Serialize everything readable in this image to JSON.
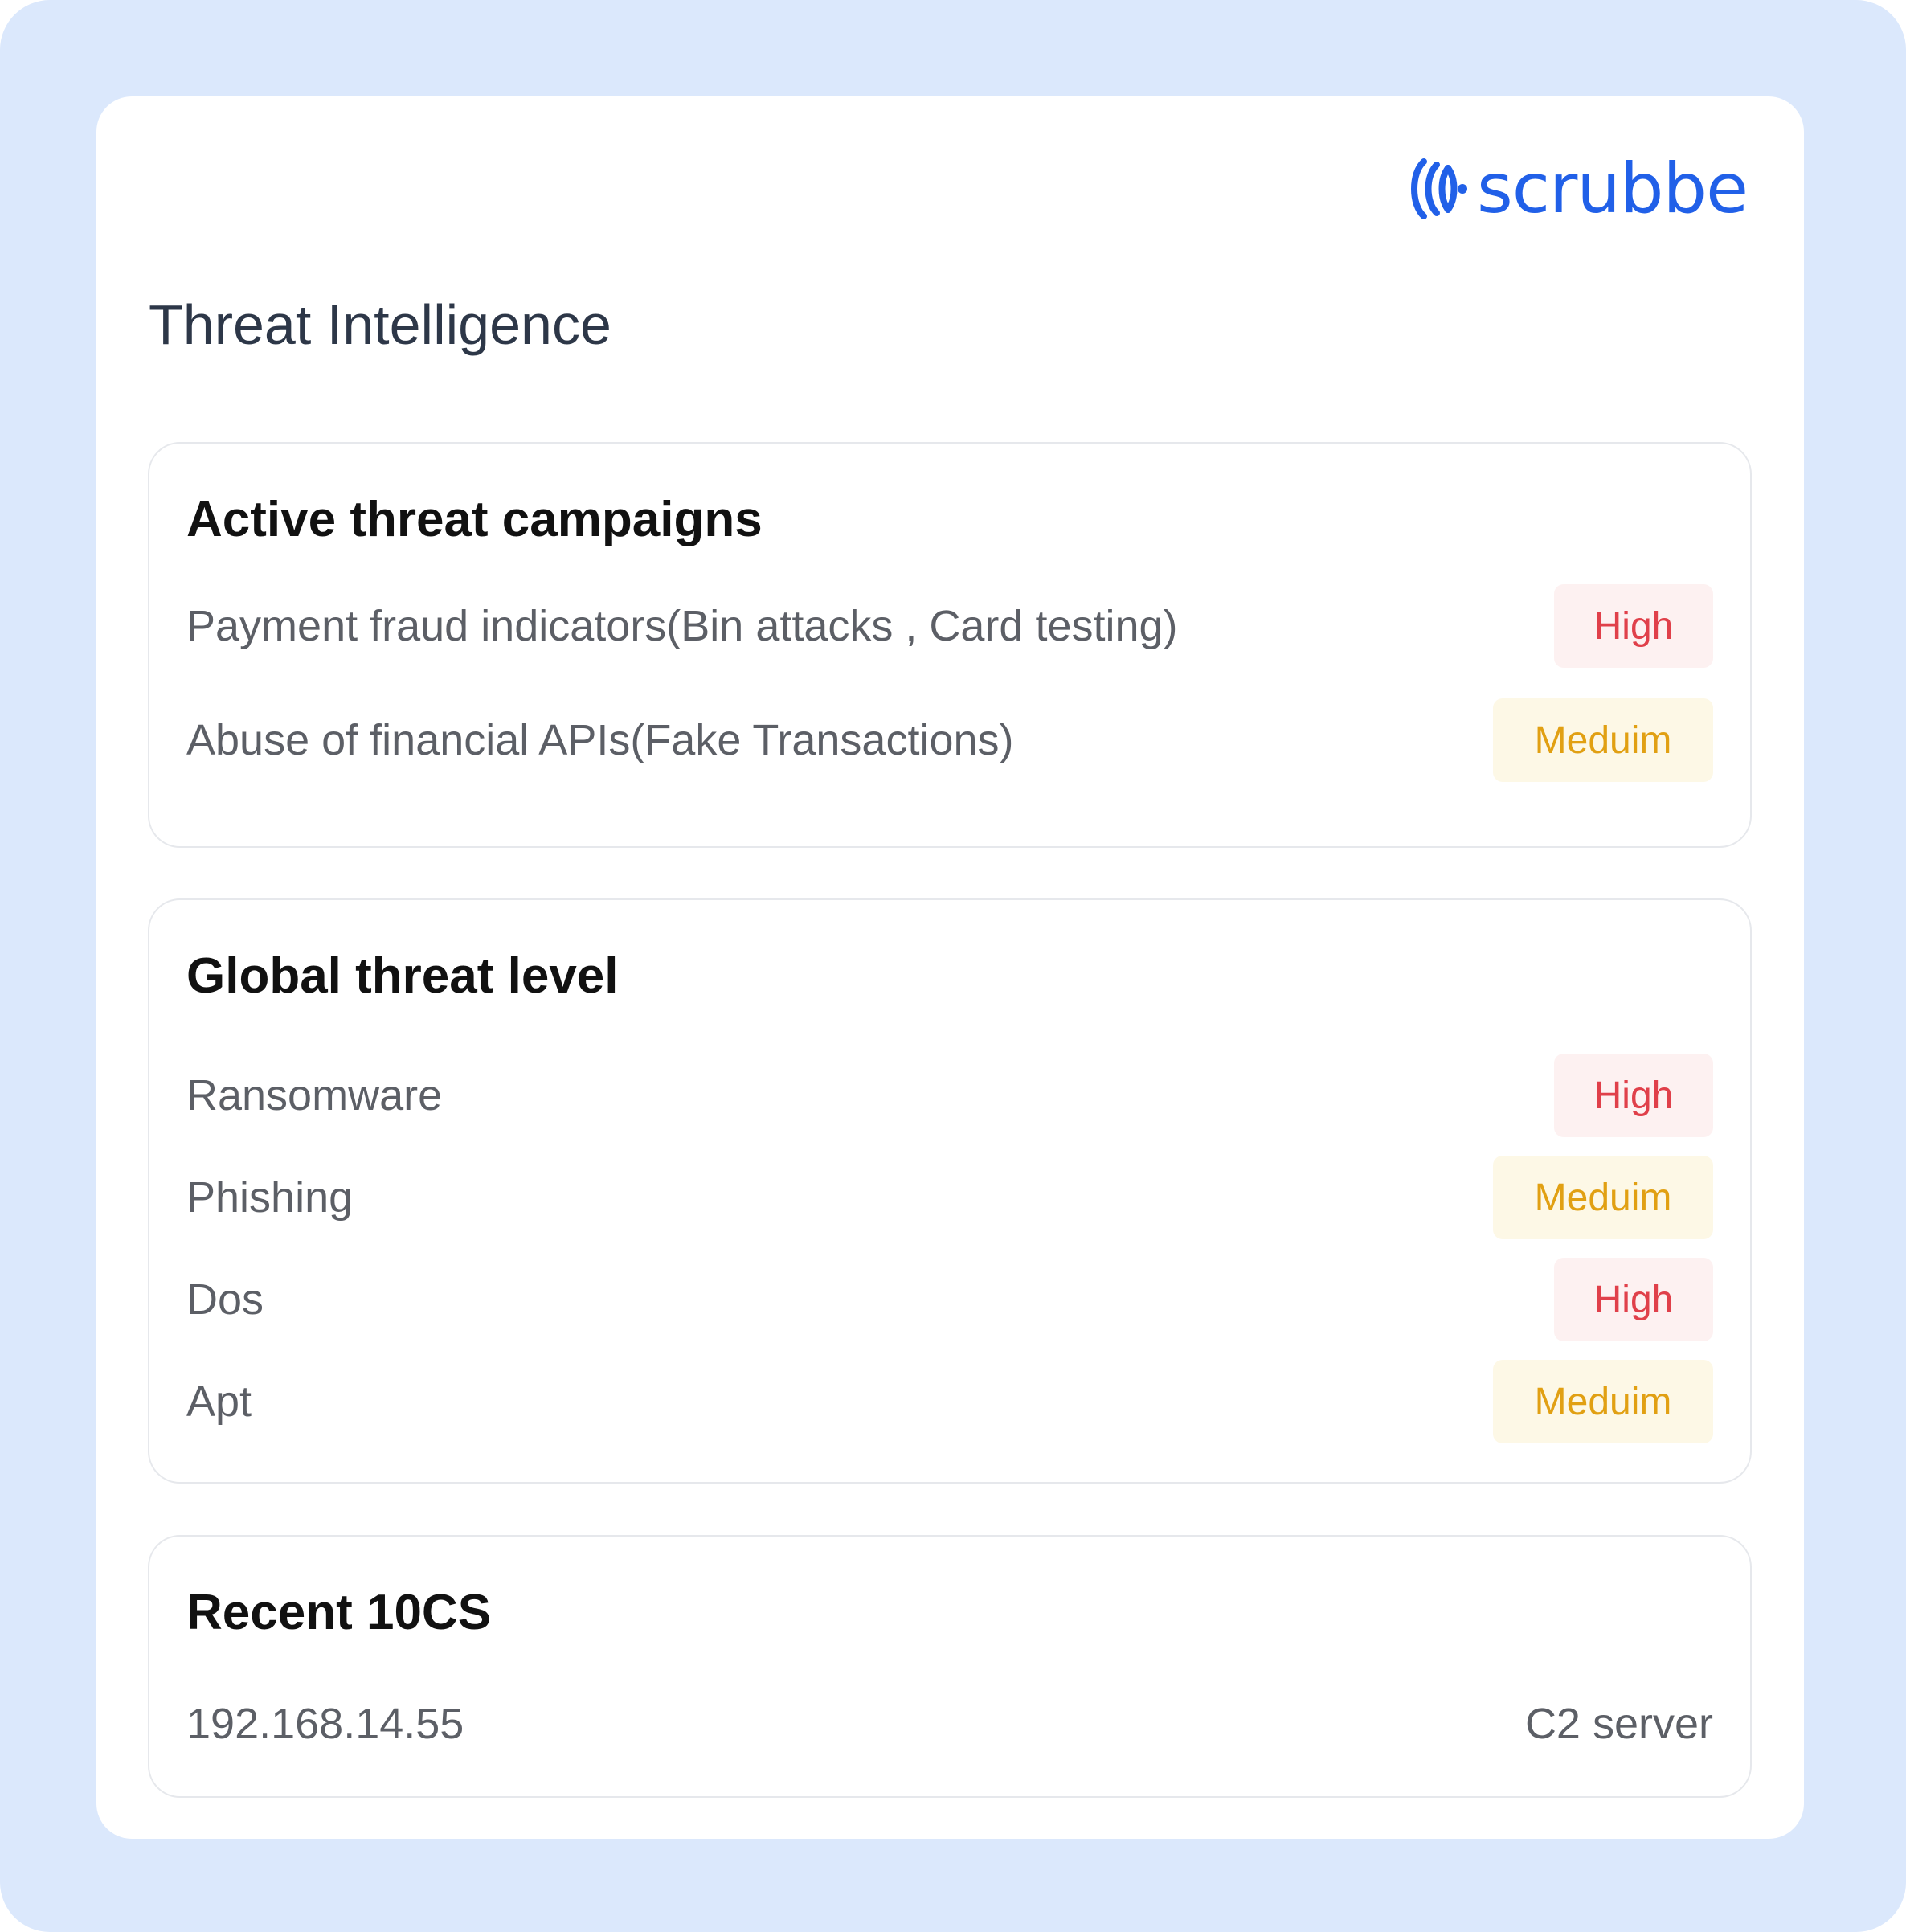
{
  "brand": {
    "name": "scrubbe",
    "logo_icon": "scrubbe-wave-icon",
    "color": "#2160e8"
  },
  "page": {
    "title": "Threat Intelligence"
  },
  "colors": {
    "background": "#dbe8fc",
    "high_text": "#e0404a",
    "high_bg": "#fdf1f1",
    "medium_text": "#e1a013",
    "medium_bg": "#fdf8e6"
  },
  "active_campaigns": {
    "title": "Active threat campaigns",
    "items": [
      {
        "label": " Payment fraud indicators(Bin attacks , Card testing)",
        "severity": "High",
        "level": "high"
      },
      {
        "label": "Abuse of financial APIs(Fake Transactions)",
        "severity": "Meduim",
        "level": "medium"
      }
    ]
  },
  "global_threat_level": {
    "title": "Global threat level",
    "items": [
      {
        "label": "Ransomware",
        "severity": "High",
        "level": "high"
      },
      {
        "label": "Phishing",
        "severity": "Meduim",
        "level": "medium"
      },
      {
        "label": "Dos",
        "severity": "High",
        "level": "high"
      },
      {
        "label": "Apt",
        "severity": "Meduim",
        "level": "medium"
      }
    ]
  },
  "recent_iocs": {
    "title": "Recent 10CS",
    "items": [
      {
        "ip": "192.168.14.55",
        "type": "C2 server"
      }
    ]
  }
}
